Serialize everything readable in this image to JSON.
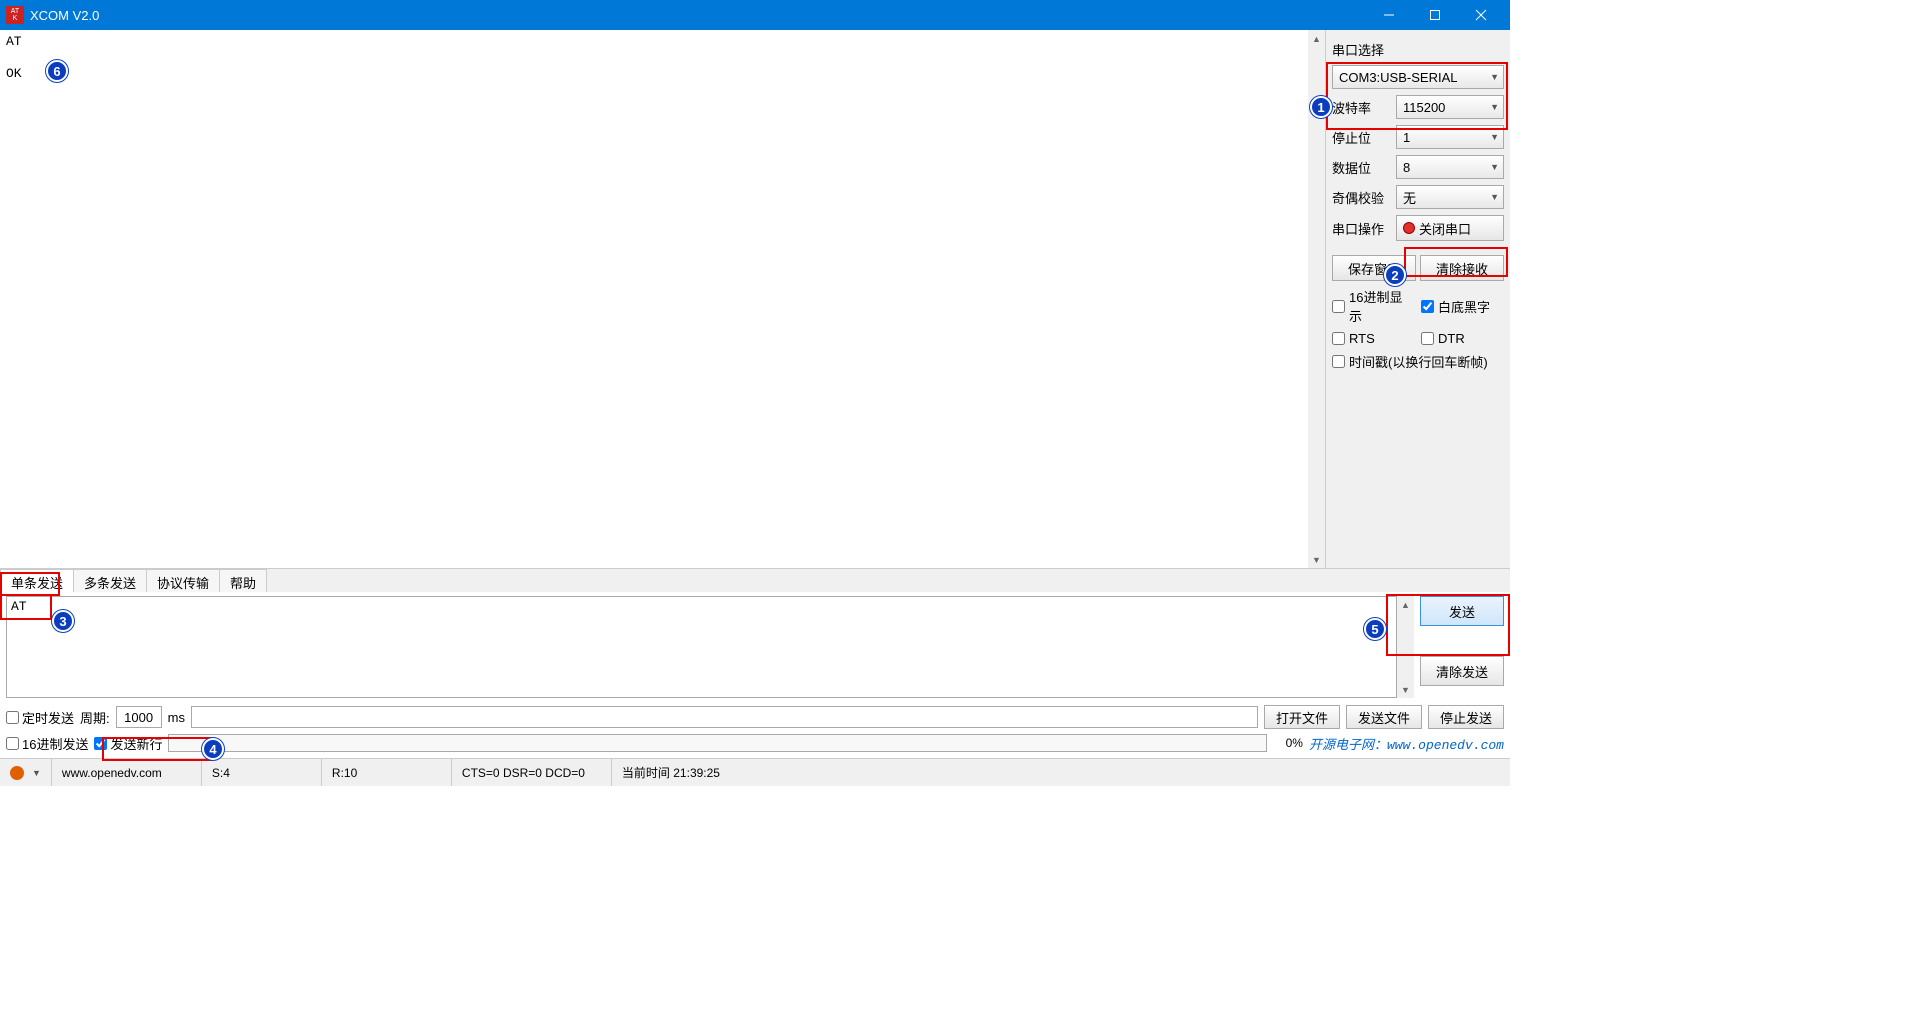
{
  "window": {
    "title": "XCOM V2.0"
  },
  "receive": {
    "text": "AT\n\nOK"
  },
  "side": {
    "section_label": "串口选择",
    "port_value": "COM3:USB-SERIAL",
    "baud_label": "波特率",
    "baud_value": "115200",
    "stop_label": "停止位",
    "stop_value": "1",
    "data_label": "数据位",
    "data_value": "8",
    "parity_label": "奇偶校验",
    "parity_value": "无",
    "op_label": "串口操作",
    "op_btn": "关闭串口",
    "save_btn": "保存窗口",
    "clear_rx_btn": "清除接收",
    "chk_hex_disp": "16进制显示",
    "chk_white_bg": "白底黑字",
    "chk_rts": "RTS",
    "chk_dtr": "DTR",
    "chk_ts": "时间戳(以换行回车断帧)"
  },
  "tabs": {
    "t1": "单条发送",
    "t2": "多条发送",
    "t3": "协议传输",
    "t4": "帮助"
  },
  "send": {
    "text": "AT",
    "send_btn": "发送",
    "clear_btn": "清除发送"
  },
  "opts": {
    "chk_timed": "定时发送",
    "period_label": "周期:",
    "period_value": "1000",
    "period_unit": "ms",
    "open_file": "打开文件",
    "send_file": "发送文件",
    "stop_send": "停止发送",
    "chk_hex_send": "16进制发送",
    "chk_newline": "发送新行",
    "pct": "0%",
    "link_text": "开源电子网：www.openedv.com"
  },
  "status": {
    "url": "www.openedv.com",
    "s": "S:4",
    "r": "R:10",
    "cts": "CTS=0 DSR=0 DCD=0",
    "time": "当前时间 21:39:25"
  },
  "callouts": {
    "c1": "1",
    "c2": "2",
    "c3": "3",
    "c4": "4",
    "c5": "5",
    "c6": "6"
  }
}
